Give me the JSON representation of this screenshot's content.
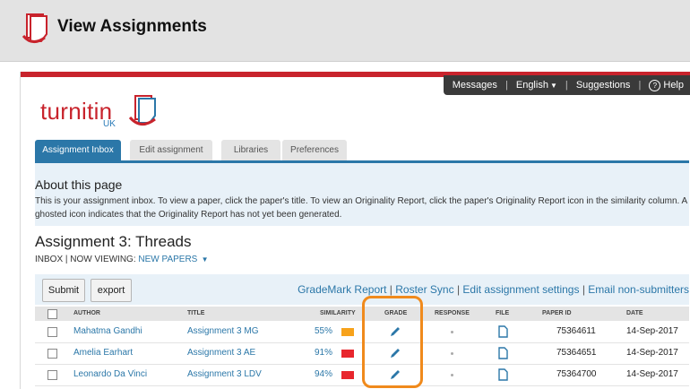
{
  "outer": {
    "title": "View Assignments"
  },
  "topnav": {
    "messages": "Messages",
    "language": "English",
    "suggestions": "Suggestions",
    "help": "Help"
  },
  "logo": {
    "text": "turnitin",
    "region": "UK"
  },
  "tabs": [
    {
      "label": "Assignment Inbox",
      "active": true
    },
    {
      "label": "Edit assignment",
      "active": false
    },
    {
      "label": "Libraries",
      "active": false
    },
    {
      "label": "Preferences",
      "active": false
    }
  ],
  "about": {
    "title": "About this page",
    "text": "This is your assignment inbox. To view a paper, click the paper's title. To view an Originality Report, click the paper's Originality Report icon in the similarity column. A ghosted icon indicates that the Originality Report has not yet been generated."
  },
  "assignment": {
    "title": "Assignment 3: Threads",
    "inbox": "INBOX",
    "now_viewing": "| NOW VIEWING:",
    "filter": "NEW PAPERS"
  },
  "toolbar": {
    "submit": "Submit",
    "export": "export",
    "links": [
      "GradeMark Report",
      "Roster Sync",
      "Edit assignment settings",
      "Email non-submitters"
    ]
  },
  "table": {
    "headers": {
      "author": "AUTHOR",
      "title": "TITLE",
      "similarity": "SIMILARITY",
      "grade": "GRADE",
      "response": "RESPONSE",
      "file": "FILE",
      "paper_id": "PAPER ID",
      "date": "DATE"
    },
    "rows": [
      {
        "author": "Mahatma Gandhi",
        "title": "Assignment 3 MG",
        "similarity": "55%",
        "sim_color": "#f7a21b",
        "paper_id": "75364611",
        "date": "14-Sep-2017"
      },
      {
        "author": "Amelia Earhart",
        "title": "Assignment 3 AE",
        "similarity": "91%",
        "sim_color": "#e8262d",
        "paper_id": "75364651",
        "date": "14-Sep-2017"
      },
      {
        "author": "Leonardo Da Vinci",
        "title": "Assignment 3 LDV",
        "similarity": "94%",
        "sim_color": "#e8262d",
        "paper_id": "75364700",
        "date": "14-Sep-2017"
      }
    ]
  },
  "colors": {
    "brand_red": "#c8232c",
    "accent_blue": "#2b77a8",
    "highlight": "#f08a1c"
  }
}
